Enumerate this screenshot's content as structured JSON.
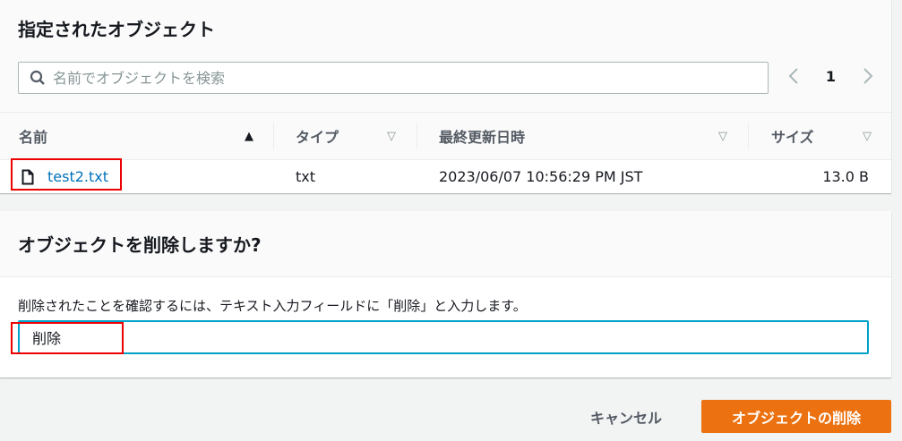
{
  "objects_panel": {
    "title": "指定されたオブジェクト",
    "search_placeholder": "名前でオブジェクトを検索",
    "pagination": {
      "current_page": "1"
    },
    "columns": [
      {
        "label": "名前",
        "sort": "ascending"
      },
      {
        "label": "タイプ",
        "sort": "none"
      },
      {
        "label": "最終更新日時",
        "sort": "none"
      },
      {
        "label": "サイズ",
        "sort": "none"
      }
    ],
    "rows": [
      {
        "name": "test2.txt",
        "type": "txt",
        "last_modified": "2023/06/07 10:56:29 PM JST",
        "size": "13.0 B"
      }
    ]
  },
  "delete_panel": {
    "title": "オブジェクトを削除しますか?",
    "description": "削除されたことを確認するには、テキスト入力フィールドに「削除」と入力します。",
    "input_value": "削除"
  },
  "actions": {
    "cancel": "キャンセル",
    "delete": "オブジェクトの削除"
  },
  "colors": {
    "primary": "#ec7211",
    "link": "#0073bb",
    "focus": "#00a1c9",
    "highlight": "#e00000"
  }
}
